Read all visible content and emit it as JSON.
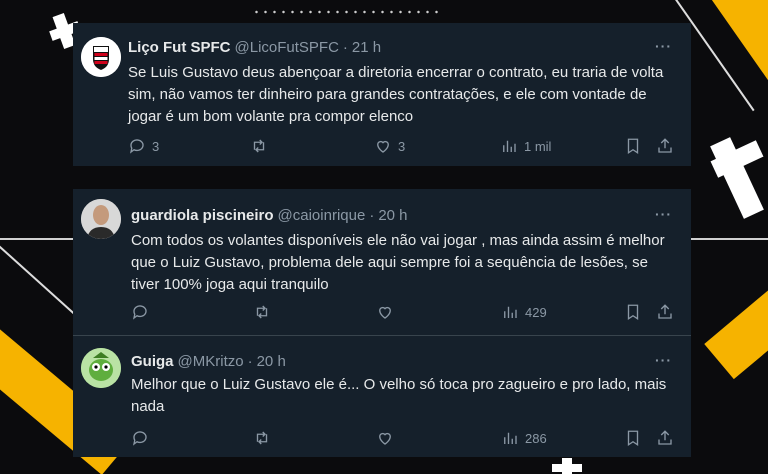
{
  "colors": {
    "card_bg": "#15202b",
    "text": "#e7e9ea",
    "muted": "#8b98a5",
    "accent_stripe": "#f6b300"
  },
  "tweets": [
    {
      "name": "Liço Fut SPFC",
      "handle": "@LicoFutSPFC",
      "separator": "·",
      "time": "21 h",
      "text": "Se Luis Gustavo deus abençoar a diretoria encerrar o contrato, eu traria de volta sim, não vamos ter dinheiro para grandes contratações, e ele com vontade de jogar é um bom volante pra compor elenco",
      "replies": "3",
      "retweets": "",
      "likes": "3",
      "views": "1 mil",
      "avatar": "spfc-crest-icon"
    },
    {
      "name": "guardiola piscineiro",
      "handle": "@caioinrique",
      "separator": "·",
      "time": "20 h",
      "text": "Com todos os volantes disponíveis ele não vai jogar , mas ainda assim é melhor que o Luiz Gustavo, problema dele aqui sempre foi a sequência de lesões, se tiver 100% joga aqui tranquilo",
      "replies": "",
      "retweets": "",
      "likes": "",
      "views": "429",
      "avatar": "man-portrait-avatar"
    },
    {
      "name": "Guiga",
      "handle": "@MKritzo",
      "separator": "·",
      "time": "20 h",
      "text": "Melhor que o Luiz Gustavo ele é... O velho só toca pro zagueiro e pro lado, mais nada",
      "replies": "",
      "retweets": "",
      "likes": "",
      "views": "286",
      "avatar": "cartoon-character-avatar"
    }
  ],
  "more_label": "···"
}
